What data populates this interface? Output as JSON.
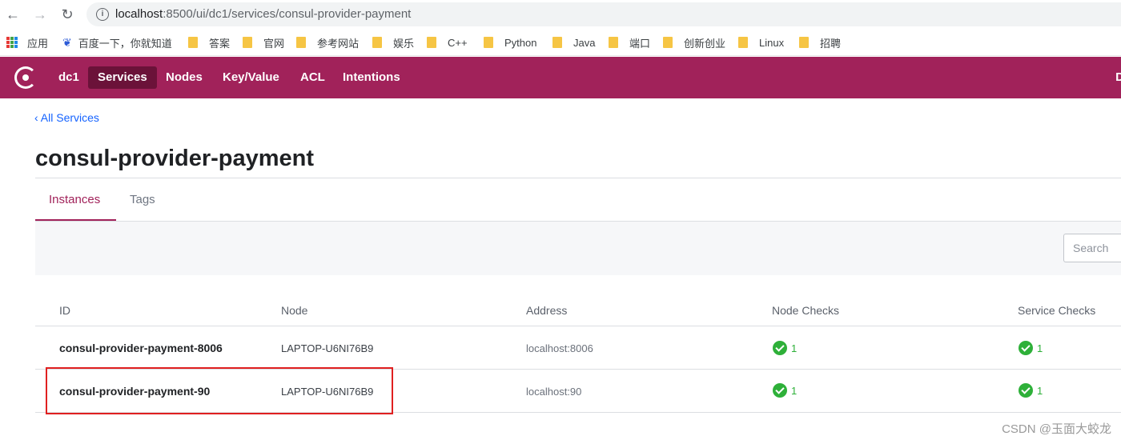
{
  "browser": {
    "back_icon": "←",
    "forward_icon": "→",
    "reload_icon": "↻",
    "info_icon": "i",
    "url_host": "localhost",
    "url_rest": ":8500/ui/dc1/services/consul-provider-payment",
    "bookmarks": [
      {
        "label": "应用",
        "icon": "apps-grid-icon"
      },
      {
        "label": "百度一下，你就知道",
        "icon": "baidu-paw-icon"
      },
      {
        "label": "答案",
        "icon": "folder-icon"
      },
      {
        "label": "官网",
        "icon": "folder-icon"
      },
      {
        "label": "参考网站",
        "icon": "folder-icon"
      },
      {
        "label": "娱乐",
        "icon": "folder-icon"
      },
      {
        "label": "C++",
        "icon": "folder-icon"
      },
      {
        "label": "Python",
        "icon": "folder-icon"
      },
      {
        "label": "Java",
        "icon": "folder-icon"
      },
      {
        "label": "端口",
        "icon": "folder-icon"
      },
      {
        "label": "创新创业",
        "icon": "folder-icon"
      },
      {
        "label": "Linux",
        "icon": "folder-icon"
      },
      {
        "label": "招聘",
        "icon": "folder-icon"
      }
    ]
  },
  "header": {
    "brand_color": "#a1225a",
    "datacenter": "dc1",
    "nav": [
      "Services",
      "Nodes",
      "Key/Value",
      "ACL",
      "Intentions"
    ],
    "active": "Services",
    "right_partial": "D"
  },
  "breadcrumb": {
    "chevron": "‹",
    "label": "All Services"
  },
  "page_title": "consul-provider-payment",
  "tabs": {
    "instances": "Instances",
    "tags": "Tags",
    "active": "Instances"
  },
  "search": {
    "placeholder": "Search",
    "value": ""
  },
  "table": {
    "headers": {
      "id": "ID",
      "node": "Node",
      "address": "Address",
      "node_checks": "Node Checks",
      "service_checks": "Service Checks"
    },
    "rows": [
      {
        "id": "consul-provider-payment-8006",
        "node": "LAPTOP-U6NI76B9",
        "address": "localhost:8006",
        "node_checks": "1",
        "service_checks": "1"
      },
      {
        "id": "consul-provider-payment-90",
        "node": "LAPTOP-U6NI76B9",
        "address": "localhost:90",
        "node_checks": "1",
        "service_checks": "1",
        "highlighted": true
      }
    ]
  },
  "watermark": "CSDN @玉面大蛟龙"
}
